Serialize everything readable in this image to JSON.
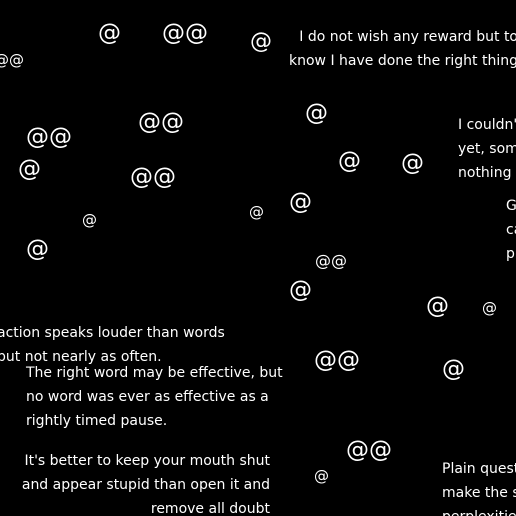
{
  "symbols": [
    "@",
    "@@",
    "@",
    "@@",
    "@",
    "@@",
    "@@",
    "@",
    "@@",
    "@",
    "@",
    "@",
    "@",
    "@",
    "@",
    "@@",
    "@",
    "@",
    "@",
    "@@",
    "@",
    "@@",
    "@"
  ],
  "quotes": [
    {
      "lines": [
        "I do not wish any reward but to",
        "know I have done the right thing"
      ]
    },
    {
      "lines": [
        "I couldn't",
        "yet, some",
        "nothing el"
      ]
    },
    {
      "lines": [
        "Go",
        "ca",
        "pl"
      ]
    },
    {
      "lines": [
        "action speaks louder than words",
        "but not nearly as often."
      ]
    },
    {
      "lines": [
        "The right word may be effective, but",
        "no word was ever as effective as a",
        "rightly timed pause."
      ]
    },
    {
      "lines": [
        "It's better to keep your mouth shut",
        "and appear stupid than open it and",
        "remove all doubt"
      ]
    },
    {
      "lines": [
        "Plain questio",
        "make the sh",
        "perplexities"
      ]
    }
  ]
}
